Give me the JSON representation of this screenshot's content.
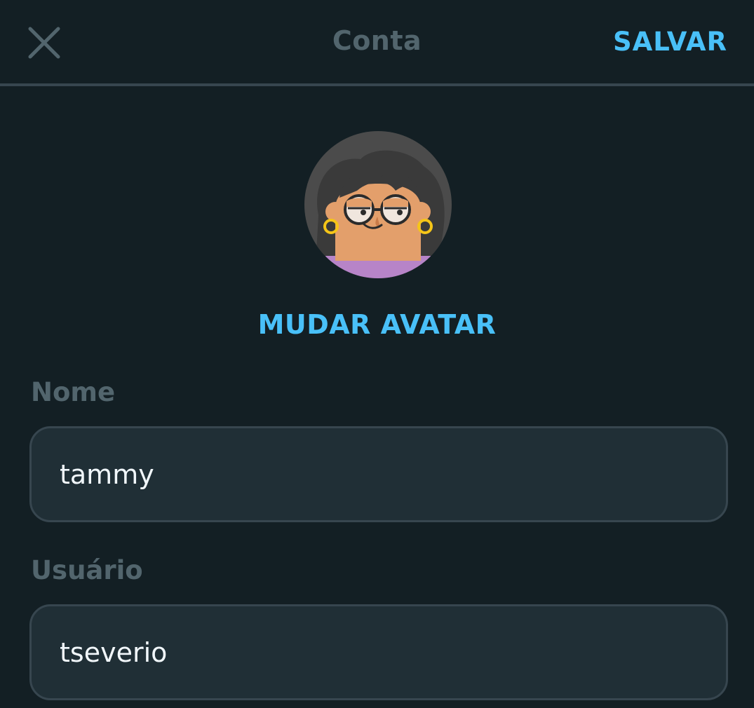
{
  "header": {
    "title": "Conta",
    "save_label": "SALVAR",
    "close_icon": "close-icon"
  },
  "avatar": {
    "change_label": "MUDAR AVATAR"
  },
  "form": {
    "name": {
      "label": "Nome",
      "value": "tammy"
    },
    "username": {
      "label": "Usuário",
      "value": "tseverio"
    }
  },
  "colors": {
    "background": "#131f24",
    "accent": "#49c0f8",
    "muted_text": "#52656d",
    "field_bg": "#202f36",
    "field_border": "#37464f"
  }
}
